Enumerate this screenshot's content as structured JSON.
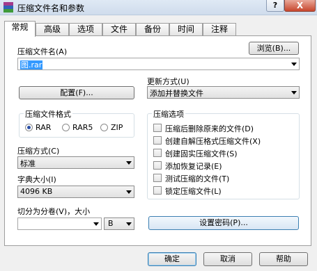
{
  "window": {
    "title": "压缩文件名和参数",
    "help_label": "?",
    "close_label": "X"
  },
  "tabs": [
    {
      "label": "常规"
    },
    {
      "label": "高级"
    },
    {
      "label": "选项"
    },
    {
      "label": "文件"
    },
    {
      "label": "备份"
    },
    {
      "label": "时间"
    },
    {
      "label": "注释"
    }
  ],
  "general": {
    "archive_name_label": "压缩文件名(A)",
    "browse_label": "浏览(B)...",
    "archive_name_value": "图.rar",
    "profile_label": "配置(F)...",
    "update_mode_label": "更新方式(U)",
    "update_mode_value": "添加并替换文件",
    "format_group_title": "压缩文件格式",
    "formats": [
      "RAR",
      "RAR5",
      "ZIP"
    ],
    "format_selected": "RAR",
    "method_label": "压缩方式(C)",
    "method_value": "标准",
    "dict_label": "字典大小(I)",
    "dict_value": "4096 KB",
    "split_label": "切分为分卷(V)，大小",
    "split_value": "",
    "split_unit": "B",
    "options_group_title": "压缩选项",
    "options": [
      {
        "label": "压缩后删除原来的文件(D)",
        "checked": false
      },
      {
        "label": "创建自解压格式压缩文件(X)",
        "checked": false
      },
      {
        "label": "创建固实压缩文件(S)",
        "checked": false
      },
      {
        "label": "添加恢复记录(E)",
        "checked": false
      },
      {
        "label": "测试压缩的文件(T)",
        "checked": false
      },
      {
        "label": "锁定压缩文件(L)",
        "checked": false
      }
    ],
    "password_label": "设置密码(P)..."
  },
  "footer": {
    "ok_label": "确定",
    "cancel_label": "取消",
    "help_label": "帮助"
  }
}
